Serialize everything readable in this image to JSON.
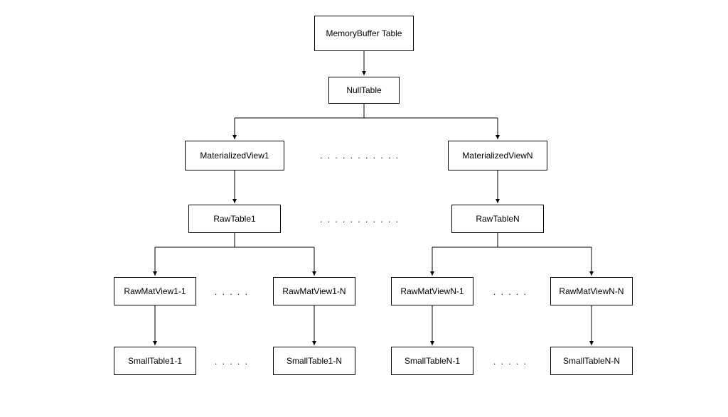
{
  "nodes": {
    "root": "MemoryBuffer Table",
    "null_table": "NullTable",
    "mv1": "MaterializedView1",
    "mvN": "MaterializedViewN",
    "raw1": "RawTable1",
    "rawN": "RawTableN",
    "rmv1_1": "RawMatView1-1",
    "rmv1_N": "RawMatView1-N",
    "rmvN_1": "RawMatViewN-1",
    "rmvN_N": "RawMatViewN-N",
    "st1_1": "SmallTable1-1",
    "st1_N": "SmallTable1-N",
    "stN_1": "SmallTableN-1",
    "stN_N": "SmallTableN-N"
  },
  "dots_long": ". . . . . . . . . . .",
  "dots_short": ". . . . ."
}
